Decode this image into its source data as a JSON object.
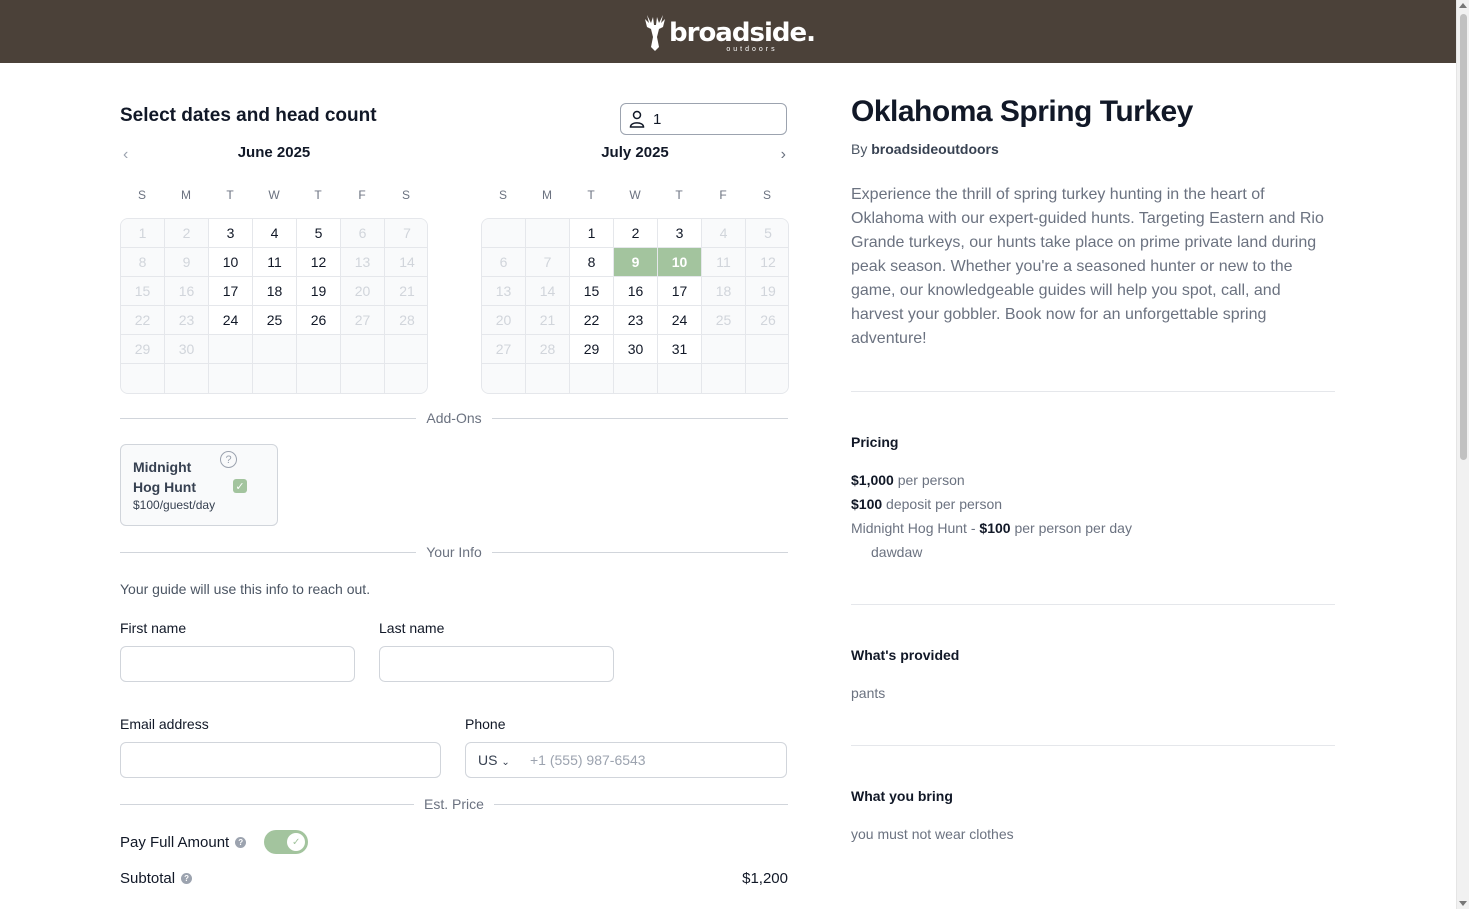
{
  "brand": {
    "name": "broadside.",
    "sub": "outdoors"
  },
  "booking": {
    "heading": "Select dates and head count",
    "headcount": "1",
    "calendars": [
      {
        "title": "June 2025",
        "nav": "‹",
        "dow": [
          "S",
          "M",
          "T",
          "W",
          "T",
          "F",
          "S"
        ],
        "cells": [
          {
            "d": "1",
            "s": "un"
          },
          {
            "d": "2",
            "s": "un"
          },
          {
            "d": "3",
            "s": "av"
          },
          {
            "d": "4",
            "s": "av"
          },
          {
            "d": "5",
            "s": "av"
          },
          {
            "d": "6",
            "s": "un"
          },
          {
            "d": "7",
            "s": "un"
          },
          {
            "d": "8",
            "s": "un"
          },
          {
            "d": "9",
            "s": "un"
          },
          {
            "d": "10",
            "s": "av"
          },
          {
            "d": "11",
            "s": "av"
          },
          {
            "d": "12",
            "s": "av"
          },
          {
            "d": "13",
            "s": "un"
          },
          {
            "d": "14",
            "s": "un"
          },
          {
            "d": "15",
            "s": "un"
          },
          {
            "d": "16",
            "s": "un"
          },
          {
            "d": "17",
            "s": "av"
          },
          {
            "d": "18",
            "s": "av"
          },
          {
            "d": "19",
            "s": "av"
          },
          {
            "d": "20",
            "s": "un"
          },
          {
            "d": "21",
            "s": "un"
          },
          {
            "d": "22",
            "s": "un"
          },
          {
            "d": "23",
            "s": "un"
          },
          {
            "d": "24",
            "s": "av"
          },
          {
            "d": "25",
            "s": "av"
          },
          {
            "d": "26",
            "s": "av"
          },
          {
            "d": "27",
            "s": "un"
          },
          {
            "d": "28",
            "s": "un"
          },
          {
            "d": "29",
            "s": "un"
          },
          {
            "d": "30",
            "s": "un"
          },
          {
            "d": "",
            "s": "em"
          },
          {
            "d": "",
            "s": "em"
          },
          {
            "d": "",
            "s": "em"
          },
          {
            "d": "",
            "s": "em"
          },
          {
            "d": "",
            "s": "em"
          },
          {
            "d": "",
            "s": "em"
          },
          {
            "d": "",
            "s": "em"
          },
          {
            "d": "",
            "s": "em"
          },
          {
            "d": "",
            "s": "em"
          },
          {
            "d": "",
            "s": "em"
          },
          {
            "d": "",
            "s": "em"
          },
          {
            "d": "",
            "s": "em"
          }
        ]
      },
      {
        "title": "July 2025",
        "nav": "›",
        "dow": [
          "S",
          "M",
          "T",
          "W",
          "T",
          "F",
          "S"
        ],
        "cells": [
          {
            "d": "",
            "s": "em"
          },
          {
            "d": "",
            "s": "em"
          },
          {
            "d": "1",
            "s": "av"
          },
          {
            "d": "2",
            "s": "av"
          },
          {
            "d": "3",
            "s": "av"
          },
          {
            "d": "4",
            "s": "un"
          },
          {
            "d": "5",
            "s": "un"
          },
          {
            "d": "6",
            "s": "un"
          },
          {
            "d": "7",
            "s": "un"
          },
          {
            "d": "8",
            "s": "av"
          },
          {
            "d": "9",
            "s": "sel"
          },
          {
            "d": "10",
            "s": "sel"
          },
          {
            "d": "11",
            "s": "un"
          },
          {
            "d": "12",
            "s": "un"
          },
          {
            "d": "13",
            "s": "un"
          },
          {
            "d": "14",
            "s": "un"
          },
          {
            "d": "15",
            "s": "av"
          },
          {
            "d": "16",
            "s": "av"
          },
          {
            "d": "17",
            "s": "av"
          },
          {
            "d": "18",
            "s": "un"
          },
          {
            "d": "19",
            "s": "un"
          },
          {
            "d": "20",
            "s": "un"
          },
          {
            "d": "21",
            "s": "un"
          },
          {
            "d": "22",
            "s": "av"
          },
          {
            "d": "23",
            "s": "av"
          },
          {
            "d": "24",
            "s": "av"
          },
          {
            "d": "25",
            "s": "un"
          },
          {
            "d": "26",
            "s": "un"
          },
          {
            "d": "27",
            "s": "un"
          },
          {
            "d": "28",
            "s": "un"
          },
          {
            "d": "29",
            "s": "av"
          },
          {
            "d": "30",
            "s": "av"
          },
          {
            "d": "31",
            "s": "av"
          },
          {
            "d": "",
            "s": "em"
          },
          {
            "d": "",
            "s": "em"
          },
          {
            "d": "",
            "s": "em"
          },
          {
            "d": "",
            "s": "em"
          },
          {
            "d": "",
            "s": "em"
          },
          {
            "d": "",
            "s": "em"
          },
          {
            "d": "",
            "s": "em"
          },
          {
            "d": "",
            "s": "em"
          },
          {
            "d": "",
            "s": "em"
          }
        ]
      }
    ],
    "addons_label": "Add-Ons",
    "addon": {
      "name": "Midnight Hog Hunt",
      "price": "$100/guest/day",
      "help": "?",
      "checked": true
    },
    "info_label": "Your Info",
    "info_hint": "Your guide will use this info to reach out.",
    "first_name_label": "First name",
    "last_name_label": "Last name",
    "email_label": "Email address",
    "phone_label": "Phone",
    "phone_country": "US",
    "phone_placeholder": "+1 (555) 987-6543",
    "price_label": "Est. Price",
    "pay_full_label": "Pay Full Amount",
    "subtotal_label": "Subtotal",
    "subtotal_value": "$1,200"
  },
  "listing": {
    "title": "Oklahoma Spring Turkey",
    "by_prefix": "By",
    "by_name": "broadsideoutdoors",
    "description": "Experience the thrill of spring turkey hunting in the heart of Oklahoma with our expert-guided hunts. Targeting Eastern and Rio Grande turkeys, our hunts take place on prime private land during peak season. Whether you're a seasoned hunter or new to the game, our knowledgeable guides will help you spot, call, and harvest your gobbler. Book now for an unforgettable spring adventure!",
    "pricing_title": "Pricing",
    "price_person": "$1,000",
    "price_person_suffix": "per person",
    "deposit": "$100",
    "deposit_suffix": "deposit per person",
    "addon_price_prefix": "Midnight Hog Hunt -",
    "addon_price": "$100",
    "addon_price_suffix": "per person per day",
    "addon_note": "dawdaw",
    "provided_title": "What's provided",
    "provided_text": "pants",
    "bring_title": "What you bring",
    "bring_text": "you must not wear clothes"
  },
  "colors": {
    "topbar": "#4b4139",
    "accent": "#a3c49e"
  }
}
